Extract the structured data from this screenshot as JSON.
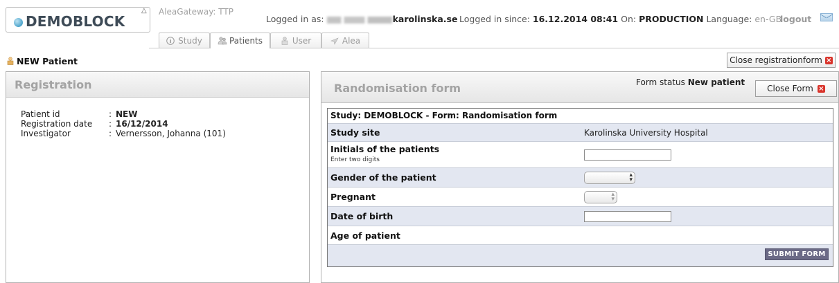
{
  "app": {
    "logo_text": "DEMOBLOCK",
    "gateway_label": "AleaGateway: TTP"
  },
  "tabs": [
    {
      "label": "Study",
      "icon": "info-icon"
    },
    {
      "label": "Patients",
      "icon": "patients-icon"
    },
    {
      "label": "User",
      "icon": "user-icon"
    },
    {
      "label": "Alea",
      "icon": "alea-icon"
    }
  ],
  "header": {
    "logged_in_label": "Logged in as:",
    "email_domain": "karolinska.se",
    "since_label": "Logged in since:",
    "since_value": "16.12.2014 08:41",
    "on_label": "On:",
    "on_value": "PRODUCTION",
    "language_label": "Language:",
    "language_value": "en-GB",
    "logout_label": "logout"
  },
  "subheader": {
    "title": "NEW Patient",
    "close_registration_label": "Close registrationform"
  },
  "registration": {
    "title": "Registration",
    "fields": [
      {
        "label": "Patient id",
        "sep": ":",
        "value": "NEW"
      },
      {
        "label": "Registration date",
        "sep": ":",
        "value": "16/12/2014"
      },
      {
        "label": "Investigator",
        "sep": ":",
        "value": "Vernersson, Johanna (101)"
      }
    ]
  },
  "randomisation": {
    "title": "Randomisation form",
    "status_label": "Form status",
    "status_value": "New patient",
    "close_form_label": "Close Form",
    "form_header": "Study: DEMOBLOCK - Form: Randomisation form",
    "rows": {
      "study_site": {
        "label": "Study site",
        "value": "Karolinska University Hospital"
      },
      "initials": {
        "label": "Initials of the patients",
        "hint": "Enter two digits",
        "value": ""
      },
      "gender": {
        "label": "Gender of the patient",
        "selected": ""
      },
      "pregnant": {
        "label": "Pregnant",
        "selected": ""
      },
      "dob": {
        "label": "Date of birth",
        "value": ""
      },
      "age": {
        "label": "Age of patient"
      }
    },
    "submit_label": "SUBMIT FORM"
  },
  "colors": {
    "row_alt": "#e3e7f1",
    "submit_bg": "#6b6a86",
    "close_x": "#d9342b",
    "title_grey": "#a3a3a3"
  }
}
